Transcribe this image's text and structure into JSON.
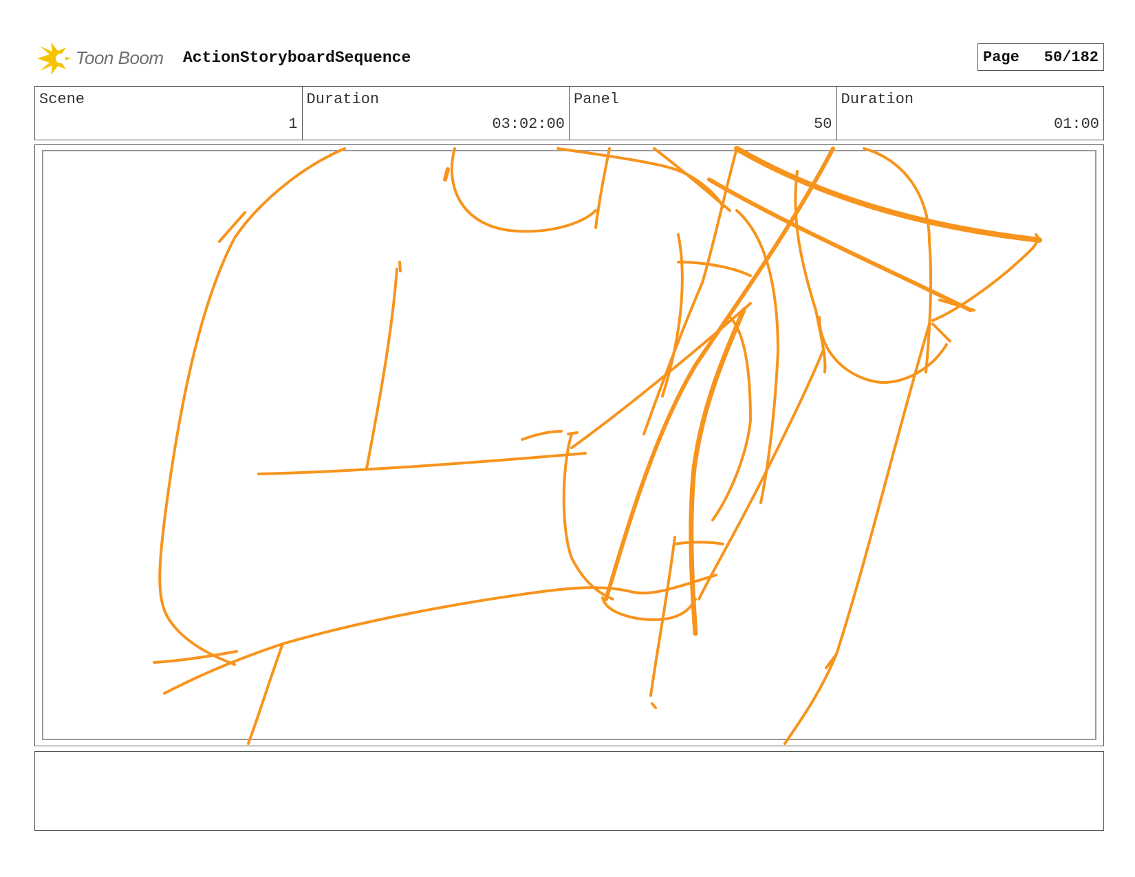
{
  "header": {
    "brand": "Toon Boom",
    "project_title": "ActionStoryboardSequence",
    "page_label": "Page",
    "page_value": "50/182"
  },
  "info": [
    {
      "label": "Scene",
      "value": "1"
    },
    {
      "label": "Duration",
      "value": "03:02:00"
    },
    {
      "label": "Panel",
      "value": "50"
    },
    {
      "label": "Duration",
      "value": "01:00"
    }
  ],
  "panel": {
    "image": "rough-sketch-drawing",
    "stroke_color": "#f7941d"
  },
  "notes": {
    "text": ""
  },
  "colors": {
    "sketch": "#f7941d",
    "logo": "#f5c400",
    "border": "#555555"
  }
}
